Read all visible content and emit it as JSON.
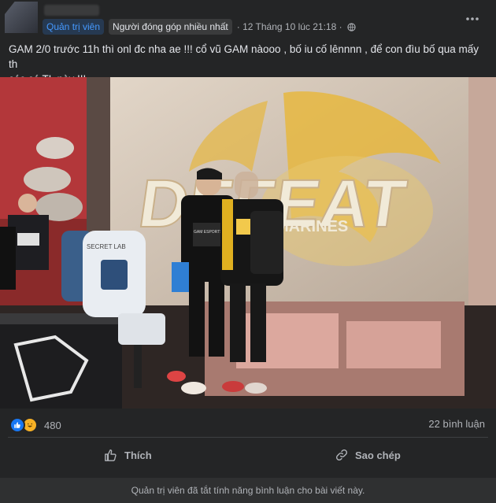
{
  "header": {
    "badge_admin": "Quản trị viên",
    "badge_contributor": "Người đóng góp nhiều nhất",
    "timestamp": "· 12 Tháng 10 lúc 21:18 ·"
  },
  "post": {
    "text_line1": "GAM 2/0 trước 11h thì onl đc nha ae !!! cổ vũ GAM nàooo , bố iu cố lênnnn , để con đìu bố qua mấy th",
    "text_line2": "cóc cé TL này !!!"
  },
  "photo": {
    "banner_text": "DEFEAT",
    "banner_sub": "MARINES",
    "player_shirt": "GAM ESPORTS",
    "desk_text": "SECRET LAB"
  },
  "stats": {
    "reaction_count": "480",
    "comment_count": "22 bình luận"
  },
  "actions": {
    "like_label": "Thích",
    "copy_label": "Sao chép"
  },
  "footer": {
    "notice": "Quản trị viên đã tắt tính năng bình luận cho bài viết này."
  },
  "colors": {
    "background": "#242526",
    "admin_badge_bg": "#263951",
    "admin_badge_text": "#4599ff",
    "like_blue": "#1877f2",
    "haha_yellow": "#f7b125"
  }
}
